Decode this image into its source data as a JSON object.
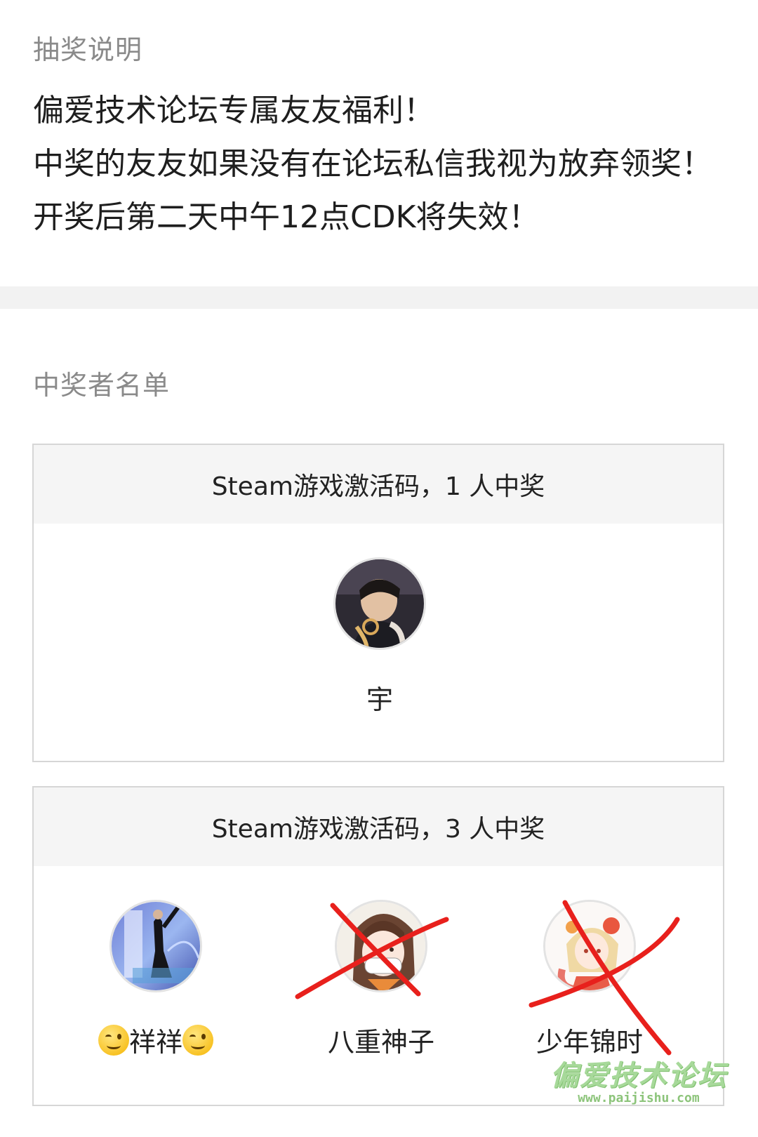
{
  "lottery_info": {
    "title": "抽奖说明",
    "lines": [
      "偏爱技术论坛专属友友福利！",
      "中奖的友友如果没有在论坛私信我视为放弃领奖！",
      "开奖后第二天中午12点CDK将失效！"
    ]
  },
  "winners_section": {
    "title": "中奖者名单",
    "prizes": [
      {
        "header": "Steam游戏激活码，1 人中奖",
        "winners": [
          {
            "name": "宇",
            "avatar_icon": "user-photo-avatar",
            "crossed_out": false
          }
        ]
      },
      {
        "header": "Steam游戏激活码，3 人中奖",
        "winners": [
          {
            "name": "祥祥",
            "name_prefix_emoji": "wink-emoji-icon",
            "name_suffix_emoji": "wink-emoji-icon",
            "avatar_icon": "concert-photo-avatar",
            "crossed_out": false
          },
          {
            "name": "八重神子",
            "avatar_icon": "anime-character-avatar",
            "crossed_out": true
          },
          {
            "name": "少年锦时",
            "avatar_icon": "anime-girl-avatar",
            "crossed_out": true
          }
        ]
      }
    ]
  },
  "watermark": {
    "main": "偏爱技术论坛",
    "sub": "www.paijishu.com"
  },
  "colors": {
    "cross_mark": "#e8201c",
    "card_border": "#d6d6d6",
    "card_header_bg": "#f5f5f5",
    "divider_bg": "#f2f2f2",
    "watermark": "#a7d99a"
  }
}
